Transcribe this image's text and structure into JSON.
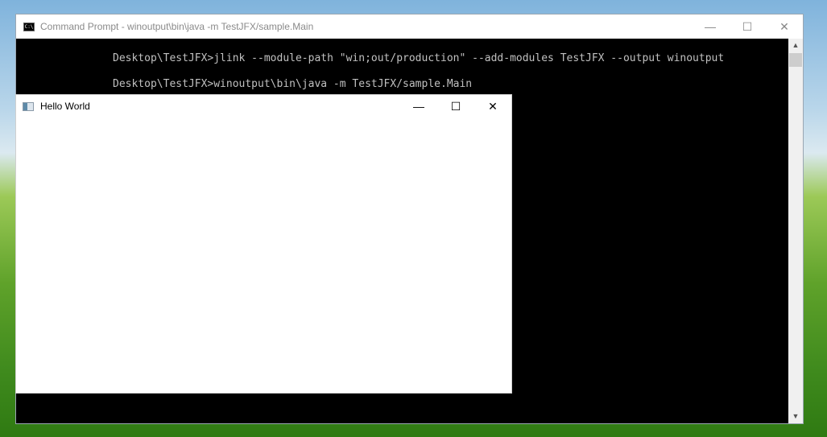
{
  "cmd": {
    "title": "Command Prompt - winoutput\\bin\\java  -m TestJFX/sample.Main",
    "lines": [
      "Desktop\\TestJFX>jlink --module-path \"win;out/production\" --add-modules TestJFX --output winoutput",
      "Desktop\\TestJFX>winoutput\\bin\\java -m TestJFX/sample.Main"
    ]
  },
  "hello": {
    "title": "Hello World"
  }
}
